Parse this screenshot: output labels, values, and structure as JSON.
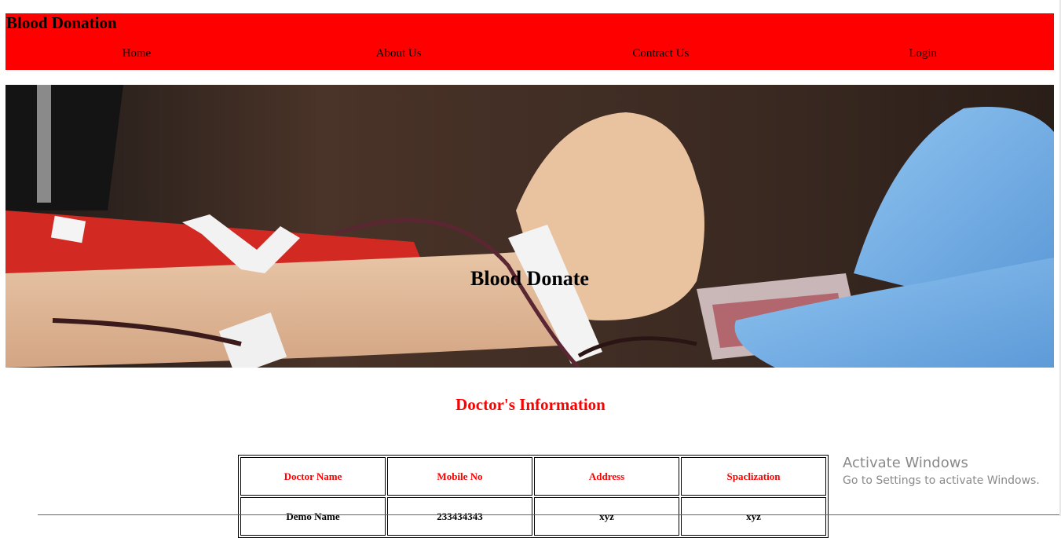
{
  "header": {
    "brand": "Blood Donation",
    "nav": [
      "Home",
      "About Us",
      "Contract Us",
      "Login"
    ]
  },
  "hero": {
    "title": "Blood Donate",
    "image": "blood-donation-photo"
  },
  "doctors": {
    "title": "Doctor's Information",
    "columns": [
      "Doctor Name",
      "Mobile No",
      "Address",
      "Spaclization"
    ],
    "rows": [
      [
        "Demo Name",
        "233434343",
        "xyz",
        "xyz"
      ]
    ]
  },
  "watermark": {
    "line1": "Activate Windows",
    "line2": "Go to Settings to activate Windows."
  },
  "colors": {
    "header_bg": "#ff0000",
    "heading_red": "#ff0000"
  }
}
